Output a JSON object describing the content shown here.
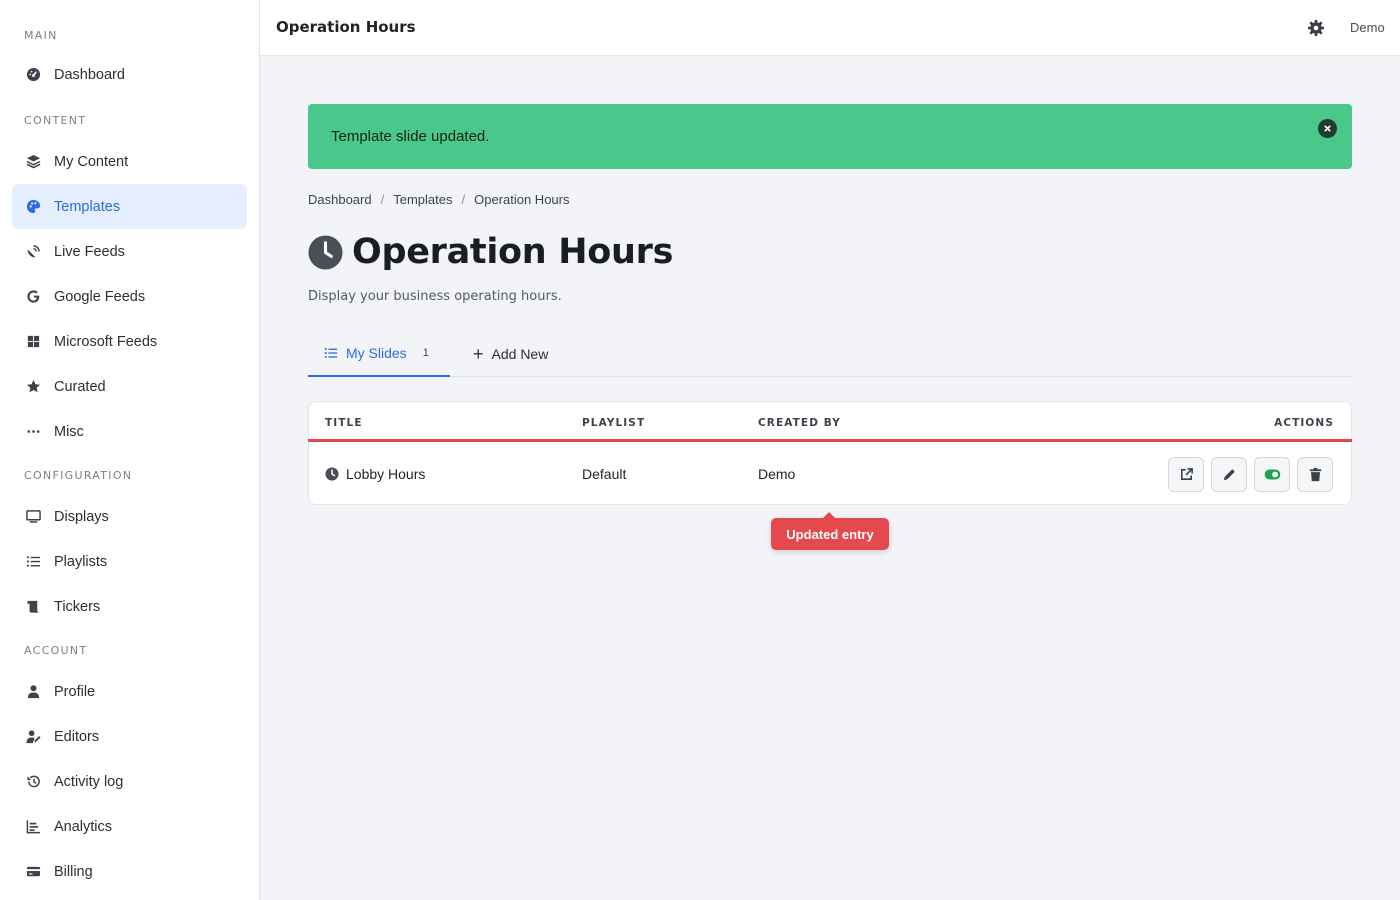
{
  "sidebar": {
    "sections": {
      "main": "MAIN",
      "content": "CONTENT",
      "configuration": "CONFIGURATION",
      "account": "ACCOUNT"
    },
    "items": {
      "dashboard": "Dashboard",
      "my_content": "My Content",
      "templates": "Templates",
      "live_feeds": "Live Feeds",
      "google_feeds": "Google Feeds",
      "microsoft_feeds": "Microsoft Feeds",
      "curated": "Curated",
      "misc": "Misc",
      "displays": "Displays",
      "playlists": "Playlists",
      "tickers": "Tickers",
      "profile": "Profile",
      "editors": "Editors",
      "activity_log": "Activity log",
      "analytics": "Analytics",
      "billing": "Billing"
    },
    "active_item": "templates"
  },
  "topbar": {
    "title": "Operation Hours",
    "user": "Demo",
    "settings_icon": "gear-icon"
  },
  "alert": {
    "message": "Template slide updated.",
    "color": "#4ac78a"
  },
  "breadcrumb": [
    "Dashboard",
    "Templates",
    "Operation Hours"
  ],
  "page": {
    "title": "Operation Hours",
    "title_icon": "clock-icon",
    "subtitle": "Display your business operating hours."
  },
  "tabs": {
    "my_slides": "My Slides",
    "my_slides_count": "1",
    "add_new": "Add New"
  },
  "table": {
    "headers": {
      "title": "TITLE",
      "playlist": "PLAYLIST",
      "created_by": "CREATED BY",
      "actions": "ACTIONS"
    },
    "rows": [
      {
        "title": "Lobby Hours",
        "playlist": "Default",
        "created_by": "Demo",
        "enabled": true
      }
    ]
  },
  "tooltip": {
    "text": "Updated entry",
    "color": "#e5484d"
  },
  "colors": {
    "accent": "#2d6be0",
    "success": "#4ac78a",
    "danger": "#e5484d",
    "toggle_on": "#1aa34a"
  }
}
